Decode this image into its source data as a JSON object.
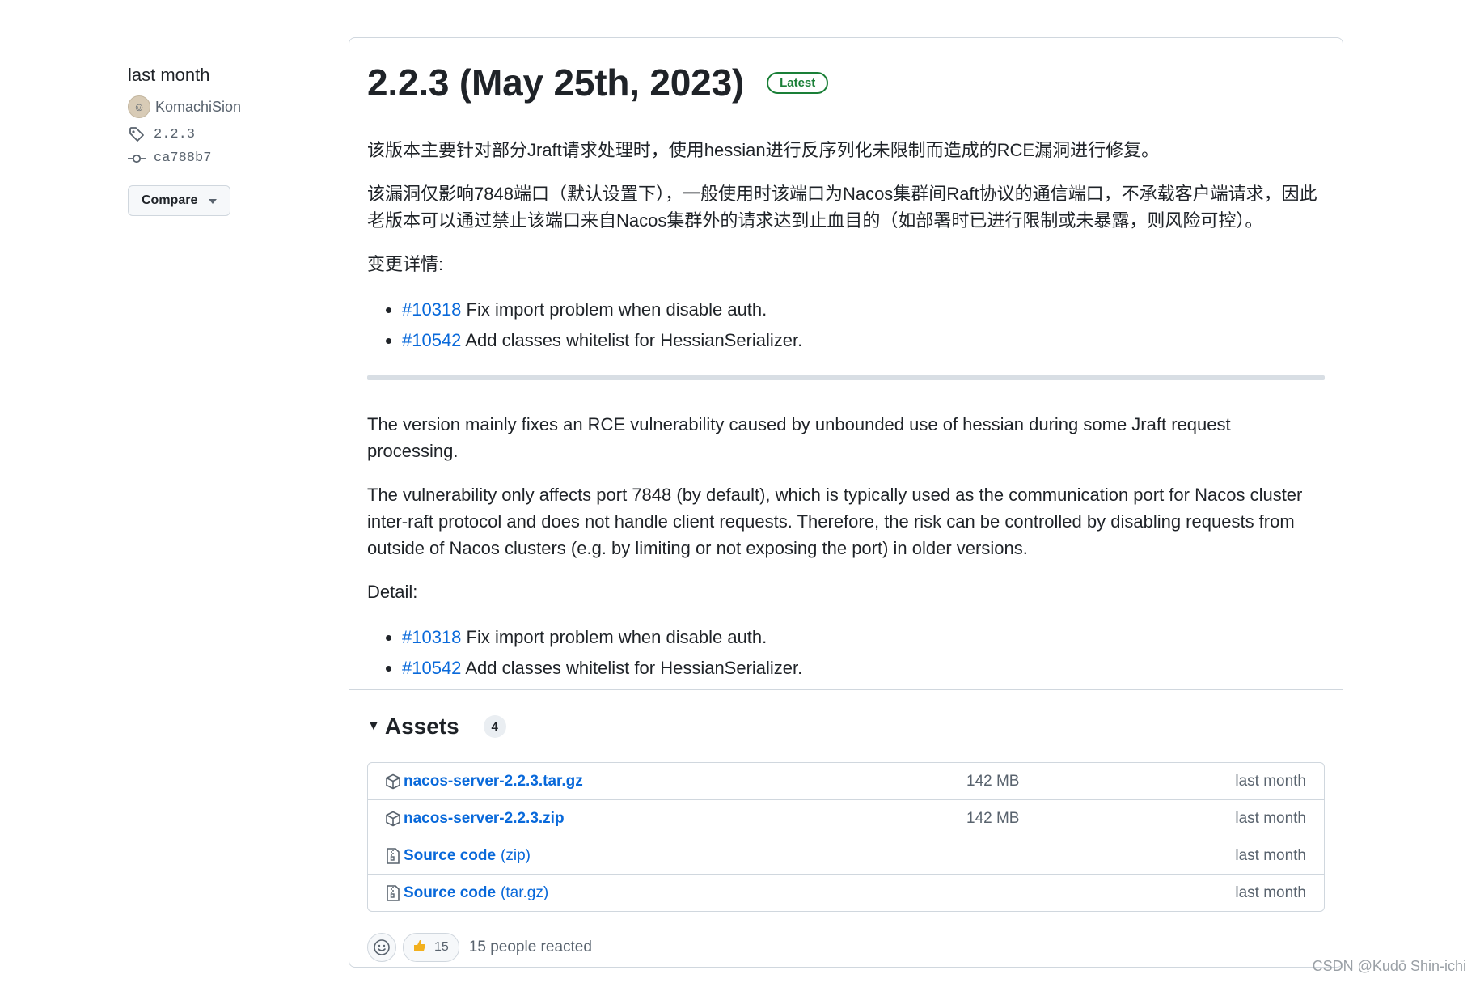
{
  "sidebar": {
    "date": "last month",
    "author": "KomachiSion",
    "tag": "2.2.3",
    "commit": "ca788b7",
    "compare_label": "Compare"
  },
  "release": {
    "title": "2.2.3 (May 25th, 2023)",
    "badge": "Latest",
    "zh": {
      "p1": "该版本主要针对部分Jraft请求处理时，使用hessian进行反序列化未限制而造成的RCE漏洞进行修复。",
      "p2": "该漏洞仅影响7848端口（默认设置下），一般使用时该端口为Nacos集群间Raft协议的通信端口，不承载客户端请求，因此老版本可以通过禁止该端口来自Nacos集群外的请求达到止血目的（如部署时已进行限制或未暴露，则风险可控）。",
      "detail_label": "变更详情:",
      "changes": [
        {
          "pr": "#10318",
          "text": " Fix import problem when disable auth."
        },
        {
          "pr": "#10542",
          "text": " Add classes whitelist for HessianSerializer."
        }
      ]
    },
    "en": {
      "p1": "The version mainly fixes an RCE vulnerability caused by unbounded use of hessian during some Jraft request processing.",
      "p2": "The vulnerability only affects port 7848 (by default), which is typically used as the communication port for Nacos cluster inter-raft protocol and does not handle client requests. Therefore, the risk can be controlled by disabling requests from outside of Nacos clusters (e.g. by limiting or not exposing the port) in older versions.",
      "detail_label": "Detail:",
      "changes": [
        {
          "pr": "#10318",
          "text": " Fix import problem when disable auth."
        },
        {
          "pr": "#10542",
          "text": " Add classes whitelist for HessianSerializer."
        }
      ]
    }
  },
  "assets": {
    "label": "Assets",
    "count": "4",
    "items": [
      {
        "icon": "package-icon",
        "name": "nacos-server-2.2.3.tar.gz",
        "ext": "",
        "size": "142 MB",
        "date": "last month"
      },
      {
        "icon": "package-icon",
        "name": "nacos-server-2.2.3.zip",
        "ext": "",
        "size": "142 MB",
        "date": "last month"
      },
      {
        "icon": "file-zip-icon",
        "name": "Source code",
        "ext": "(zip)",
        "size": "",
        "date": "last month"
      },
      {
        "icon": "file-zip-icon",
        "name": "Source code",
        "ext": "(tar.gz)",
        "size": "",
        "date": "last month"
      }
    ]
  },
  "reactions": {
    "thumbs_up_count": "15",
    "summary": "15 people reacted"
  },
  "watermark": "CSDN @Kudō Shin-ichi"
}
